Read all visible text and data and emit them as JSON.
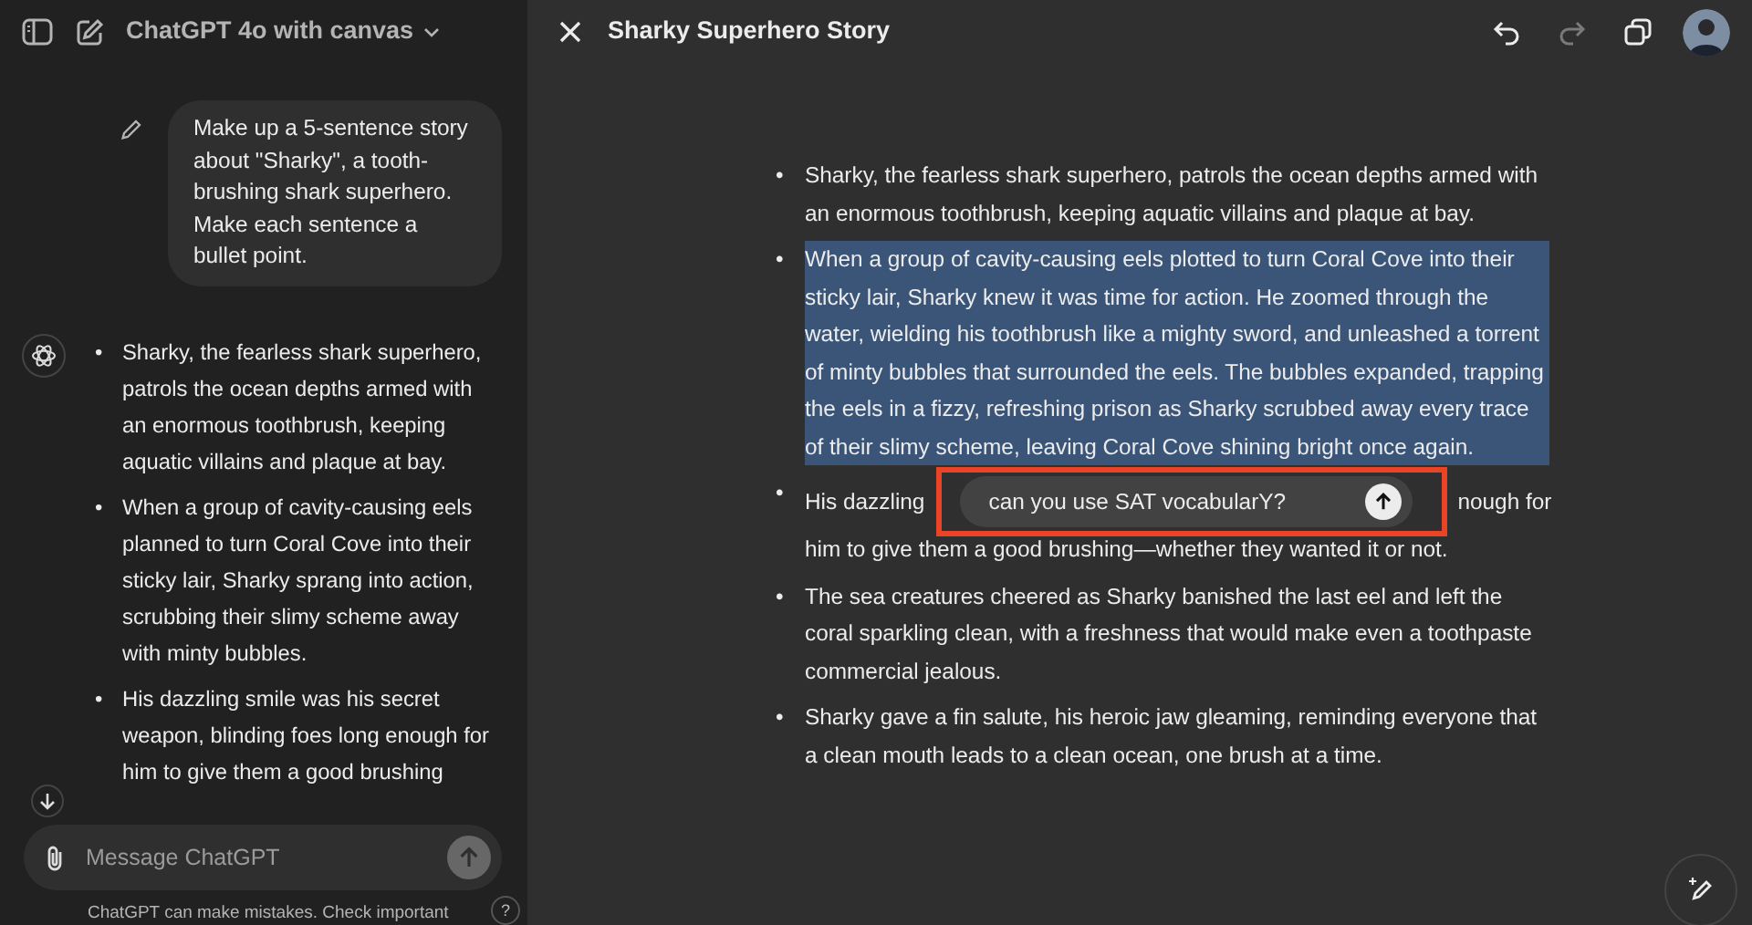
{
  "sidebar": {
    "model": "ChatGPT 4o with canvas",
    "user_message": "Make up a 5-sentence story about \"Sharky\", a tooth-brushing shark superhero. Make each sentence a bullet point.",
    "bullet": "•",
    "assistant_bullets": [
      "Sharky, the fearless shark superhero, patrols the ocean depths armed with an enormous toothbrush, keeping aquatic villains and plaque at bay.",
      "When a group of cavity-causing eels planned to turn Coral Cove into their sticky lair, Sharky sprang into action, scrubbing their slimy scheme away with minty bubbles.",
      "His dazzling smile was his secret weapon, blinding foes long enough for him to give them a good brushing"
    ],
    "composer": {
      "placeholder": "Message ChatGPT",
      "send_disabled": true
    },
    "disclaimer": "ChatGPT can make mistakes. Check important",
    "help": "?"
  },
  "canvas": {
    "title": "Sharky Superhero Story",
    "undo": {
      "disabled": false
    },
    "redo": {
      "disabled": true
    },
    "bullet": "•",
    "paragraphs": [
      {
        "kind": "text",
        "selected": false,
        "text": "Sharky, the fearless shark superhero, patrols the ocean depths armed with an enormous toothbrush, keeping aquatic villains and plaque at bay."
      },
      {
        "kind": "text",
        "selected": true,
        "text": "When a group of cavity-causing eels plotted to turn Coral Cove into their sticky lair, Sharky knew it was time for action. He zoomed through the water, wielding his toothbrush like a mighty sword, and unleashed a torrent of minty bubbles that surrounded the eels. The bubbles expanded, trapping the eels in a fizzy, refreshing prison as Sharky scrubbed away every trace of their slimy scheme, leaving Coral Cove shining bright once again."
      },
      {
        "kind": "prompt",
        "selected": false,
        "before": "His dazzling",
        "after": "nough for",
        "rest": "him to give them a good brushing—whether they wanted it or not.",
        "prompt": {
          "value": "can you use SAT vocabularY?"
        }
      },
      {
        "kind": "text",
        "selected": false,
        "text": "The sea creatures cheered as Sharky banished the last eel and left the coral sparkling clean, with a freshness that would make even a toothpaste commercial jealous."
      },
      {
        "kind": "text",
        "selected": false,
        "text": "Sharky gave a fin salute, his heroic jaw gleaming, reminding everyone that a clean mouth leads to a clean ocean, one brush at a time."
      }
    ]
  }
}
